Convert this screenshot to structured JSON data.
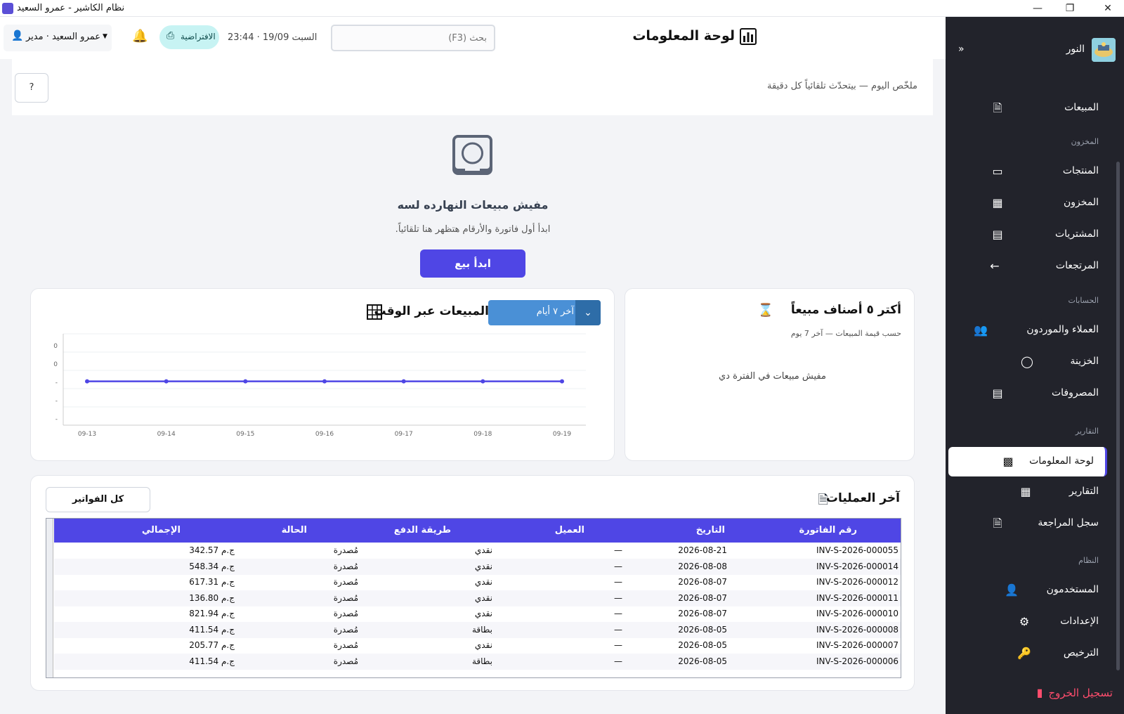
{
  "window": {
    "title": "نظام الكاشير - عمرو السعيد"
  },
  "sidebar": {
    "brand": "النور",
    "collapse_glyph": "»",
    "items": [
      {
        "label": "المبيعات",
        "icon": "receipt-icon"
      },
      {
        "label": "المنتجات",
        "icon": "box-icon"
      },
      {
        "label": "المخزون",
        "icon": "warehouse-icon"
      },
      {
        "label": "المشتريات",
        "icon": "purchase-icon"
      },
      {
        "label": "المرتجعات",
        "icon": "return-arrow-icon"
      },
      {
        "label": "العملاء والموردون",
        "icon": "people-icon"
      },
      {
        "label": "الخزينة",
        "icon": "money-bag-icon"
      },
      {
        "label": "المصروفات",
        "icon": "expense-icon"
      },
      {
        "label": "لوحة المعلومات",
        "icon": "dashboard-icon"
      },
      {
        "label": "التقارير",
        "icon": "report-chart-icon"
      },
      {
        "label": "سجل المراجعة",
        "icon": "audit-log-icon"
      },
      {
        "label": "المستخدمون",
        "icon": "user-icon"
      },
      {
        "label": "الإعدادات",
        "icon": "gear-icon"
      },
      {
        "label": "الترخيص",
        "icon": "key-icon"
      }
    ],
    "sections": {
      "inventory": "المخزون",
      "accounts": "الحسابات",
      "reports": "التقارير",
      "system": "النظام"
    },
    "logout": "تسجيل الخروج"
  },
  "header": {
    "title": "لوحة المعلومات",
    "search_placeholder": "بحث (F3)",
    "datetime": "السبت 19/09 · 23:44",
    "printer": "الافتراضية",
    "user": "عمرو السعيد · مدير"
  },
  "summary": {
    "text": "ملخّص اليوم — بيتحدّث تلقائياً كل دقيقة",
    "help": "?"
  },
  "empty": {
    "title": "مفيش مبيعات النهارده لسه",
    "subtitle": ".ابدأ أول فاتورة والأرقام هتظهر هنا تلقائياً",
    "button": "ابدأ بيع"
  },
  "top5": {
    "title": "أكتر ٥ أصناف مبيعاً",
    "subtitle": "حسب قيمة المبيعات — آخر 7 يوم",
    "empty": "مفيش مبيعات في الفترة دي"
  },
  "sales_chart": {
    "title": "المبيعات عبر الوقت",
    "range": "آخر ٧ أيام"
  },
  "chart_data": {
    "type": "line",
    "categories": [
      "09-13",
      "09-14",
      "09-15",
      "09-16",
      "09-17",
      "09-18",
      "09-19"
    ],
    "series": [
      {
        "values": [
          0,
          0,
          0,
          0,
          0,
          0,
          0
        ],
        "color": "#4f46e5"
      }
    ],
    "yticks": [
      "0",
      "0",
      "-",
      "-",
      "-"
    ],
    "grid": true
  },
  "recent": {
    "title": "آخر العمليات",
    "all_button": "كل الفواتير",
    "columns": [
      "رقم الفاتورة",
      "التاريخ",
      "العميل",
      "طريقة الدفع",
      "الحالة",
      "الإجمالي"
    ],
    "rows": [
      [
        "INV-S-2026-000055",
        "2026-08-21",
        "—",
        "نقدي",
        "مُصدرة",
        "342.57 ج.م"
      ],
      [
        "INV-S-2026-000014",
        "2026-08-08",
        "—",
        "نقدي",
        "مُصدرة",
        "548.34 ج.م"
      ],
      [
        "INV-S-2026-000012",
        "2026-08-07",
        "—",
        "نقدي",
        "مُصدرة",
        "617.31 ج.م"
      ],
      [
        "INV-S-2026-000011",
        "2026-08-07",
        "—",
        "نقدي",
        "مُصدرة",
        "136.80 ج.م"
      ],
      [
        "INV-S-2026-000010",
        "2026-08-07",
        "—",
        "نقدي",
        "مُصدرة",
        "821.94 ج.م"
      ],
      [
        "INV-S-2026-000008",
        "2026-08-05",
        "—",
        "بطاقة",
        "مُصدرة",
        "411.54 ج.م"
      ],
      [
        "INV-S-2026-000007",
        "2026-08-05",
        "—",
        "نقدي",
        "مُصدرة",
        "205.77 ج.م"
      ],
      [
        "INV-S-2026-000006",
        "2026-08-05",
        "—",
        "بطاقة",
        "مُصدرة",
        "411.54 ج.م"
      ]
    ]
  },
  "colors": {
    "accent": "#4f46e5",
    "sidebar_bg": "#22232b",
    "logout": "#ff4d6d"
  }
}
